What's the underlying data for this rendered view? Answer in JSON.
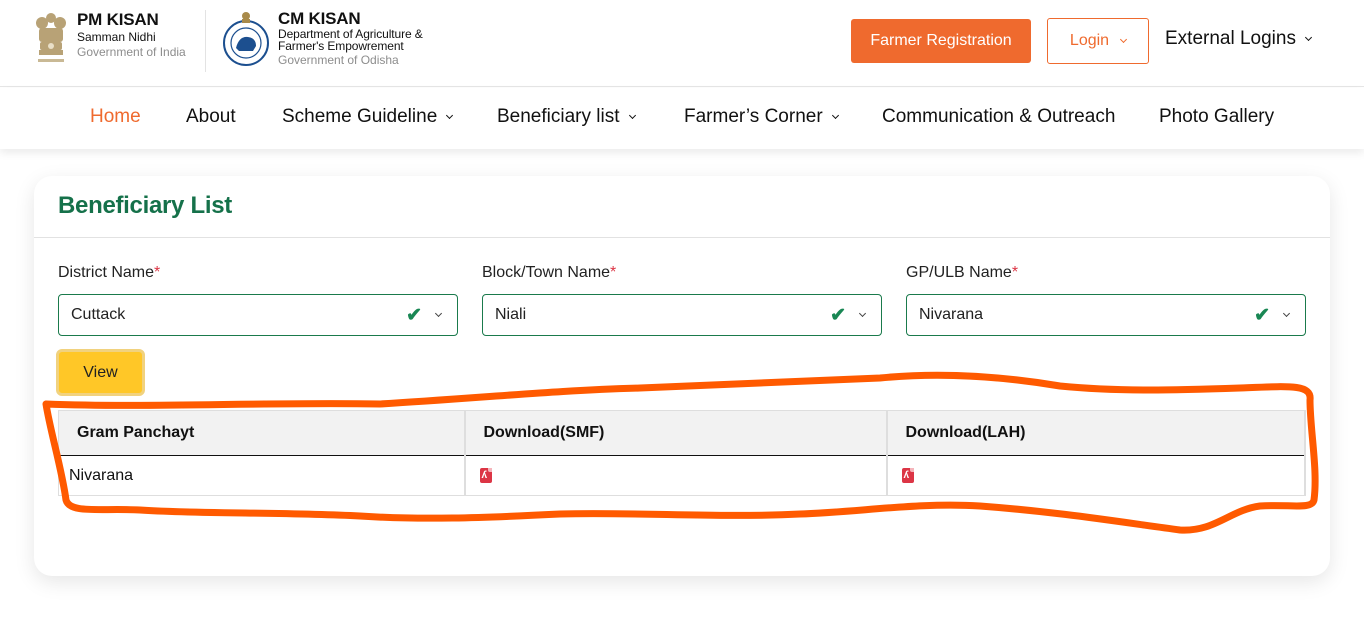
{
  "header": {
    "pm_kisan": {
      "title": "PM KISAN",
      "subtitle": "Samman Nidhi",
      "gov": "Government of India"
    },
    "cm_kisan": {
      "title": "CM KISAN",
      "dept_line1": "Department of Agriculture &",
      "dept_line2": "Farmer's Empowrement",
      "gov": "Government of Odisha"
    },
    "farmer_registration_label": "Farmer Registration",
    "login_label": "Login",
    "external_logins_label": "External Logins"
  },
  "nav": {
    "items": [
      {
        "label": "Home",
        "active": true,
        "dropdown": false
      },
      {
        "label": "About",
        "active": false,
        "dropdown": false
      },
      {
        "label": "Scheme Guideline",
        "active": false,
        "dropdown": true
      },
      {
        "label": "Beneficiary list",
        "active": false,
        "dropdown": true
      },
      {
        "label": "Farmer’s Corner",
        "active": false,
        "dropdown": true
      },
      {
        "label": "Communication & Outreach",
        "active": false,
        "dropdown": false
      },
      {
        "label": "Photo Gallery",
        "active": false,
        "dropdown": false
      }
    ]
  },
  "card": {
    "title": "Beneficiary List",
    "fields": [
      {
        "label": "District Name",
        "required_mark": "*",
        "value": "Cuttack"
      },
      {
        "label": "Block/Town Name",
        "required_mark": "*",
        "value": "Niali"
      },
      {
        "label": "GP/ULB Name",
        "required_mark": "*",
        "value": "Nivarana"
      }
    ],
    "view_label": "View",
    "table": {
      "headers": [
        "Gram Panchayt",
        "Download(SMF)",
        "Download(LAH)"
      ],
      "rows": [
        {
          "gram_panchayat": "Nivarana",
          "smf": "pdf-icon",
          "lah": "pdf-icon"
        }
      ]
    }
  },
  "colors": {
    "brand_orange": "#ef6a2e",
    "title_green": "#15714a",
    "view_yellow": "#ffc727",
    "annotation_orange": "#ff5a00"
  }
}
